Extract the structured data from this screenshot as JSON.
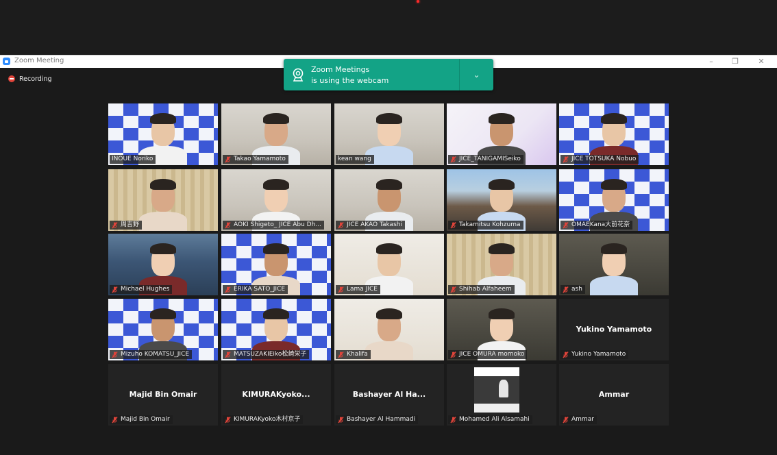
{
  "window": {
    "title": "Zoom Meeting",
    "controls": {
      "minimize": "–",
      "restore": "❐",
      "close": "✕"
    }
  },
  "recording": {
    "label": "Recording",
    "icon": "recording-icon"
  },
  "notification": {
    "line1": "Zoom Meetings",
    "line2": "is using the webcam",
    "icon": "webcam-icon",
    "expand_icon": "⌄",
    "color": "#13a386"
  },
  "colors": {
    "background": "#1a1a1a",
    "active_speaker_border": "#e7e64a",
    "mute_icon": "#e0443a",
    "tile_empty": "#232323"
  },
  "participants": [
    {
      "name": "INOUE Noriko",
      "muted": false,
      "video": "checker",
      "active": true
    },
    {
      "name": "Takao Yamamoto",
      "muted": true,
      "video": "office"
    },
    {
      "name": "kean wang",
      "muted": false,
      "video": "office"
    },
    {
      "name": "JICE_TANIGAMISeiko",
      "muted": true,
      "video": "slide"
    },
    {
      "name": "JICE TOTSUKA Nobuo",
      "muted": true,
      "video": "checker"
    },
    {
      "name": "周吉野",
      "muted": true,
      "video": "curtain"
    },
    {
      "name": "AOKI Shigeto_ JICE Abu Dh...",
      "muted": true,
      "video": "office"
    },
    {
      "name": "JICE AKAO Takashi",
      "muted": true,
      "video": "office"
    },
    {
      "name": "Takamitsu Kohzuma",
      "muted": true,
      "video": "outdoor"
    },
    {
      "name": "OMAEKana大前花奈",
      "muted": true,
      "video": "checker"
    },
    {
      "name": "Michael Hughes",
      "muted": true,
      "video": "building"
    },
    {
      "name": "ERIKA SATO_JICE",
      "muted": true,
      "video": "checker"
    },
    {
      "name": "Lama JICE",
      "muted": true,
      "video": "room"
    },
    {
      "name": "Shihab Alfaheem",
      "muted": true,
      "video": "curtain"
    },
    {
      "name": "ash",
      "muted": true,
      "video": "dim"
    },
    {
      "name": "Mizuho KOMATSU_JICE",
      "muted": true,
      "video": "checker"
    },
    {
      "name": "MATSUZAKIEiko松崎栄子",
      "muted": true,
      "video": "checker"
    },
    {
      "name": "Khalifa",
      "muted": true,
      "video": "room"
    },
    {
      "name": "JICE  OMURA momoko",
      "muted": true,
      "video": "dim"
    },
    {
      "name": "Yukino Yamamoto",
      "muted": true,
      "video": "none",
      "display_name": "Yukino Yamamoto"
    },
    {
      "name": "Majid Bin Omair",
      "muted": true,
      "video": "none",
      "display_name": "Majid Bin Omair"
    },
    {
      "name": "KIMURAKyoko木村京子",
      "muted": true,
      "video": "none",
      "display_name": "KIMURAKyoko..."
    },
    {
      "name": "Bashayer Al Hammadi",
      "muted": true,
      "video": "none",
      "display_name": "Bashayer Al Ha..."
    },
    {
      "name": "Mohamed Ali Alsamahi",
      "muted": true,
      "video": "photo"
    },
    {
      "name": "Ammar",
      "muted": true,
      "video": "none",
      "display_name": "Ammar"
    }
  ]
}
